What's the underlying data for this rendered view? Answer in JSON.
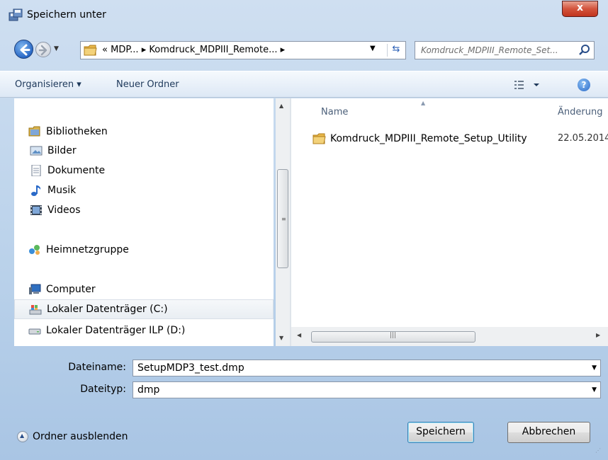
{
  "window": {
    "title": "Speichern unter",
    "close_glyph": "x"
  },
  "address": {
    "history_chevron": "«",
    "crumbs": [
      "MDP...",
      "Komdruck_MDPIII_Remote..."
    ],
    "separator": "▸"
  },
  "search": {
    "placeholder": "Komdruck_MDPIII_Remote_Set..."
  },
  "toolbar": {
    "organize": "Organisieren ▾",
    "new_folder": "Neuer Ordner",
    "help": "?"
  },
  "nav": {
    "libraries": "Bibliotheken",
    "pictures": "Bilder",
    "documents": "Dokumente",
    "music": "Musik",
    "videos": "Videos",
    "homegroup": "Heimnetzgruppe",
    "computer": "Computer",
    "drive_c": "Lokaler Datenträger (C:)",
    "drive_d": "Lokaler Datenträger ILP (D:)"
  },
  "files": {
    "columns": {
      "name": "Name",
      "date": "Änderung"
    },
    "rows": [
      {
        "name": "Komdruck_MDPIII_Remote_Setup_Utility",
        "date": "22.05.2014"
      }
    ]
  },
  "form": {
    "filename_label": "Dateiname:",
    "filename_value": "SetupMDP3_test.dmp",
    "filetype_label": "Dateityp:",
    "filetype_value": "dmp"
  },
  "footer": {
    "hide_folders": "Ordner ausblenden",
    "save": "Speichern",
    "cancel": "Abbrechen"
  },
  "colors": {
    "accent": "#2a6ac8",
    "close": "#c1341e"
  }
}
